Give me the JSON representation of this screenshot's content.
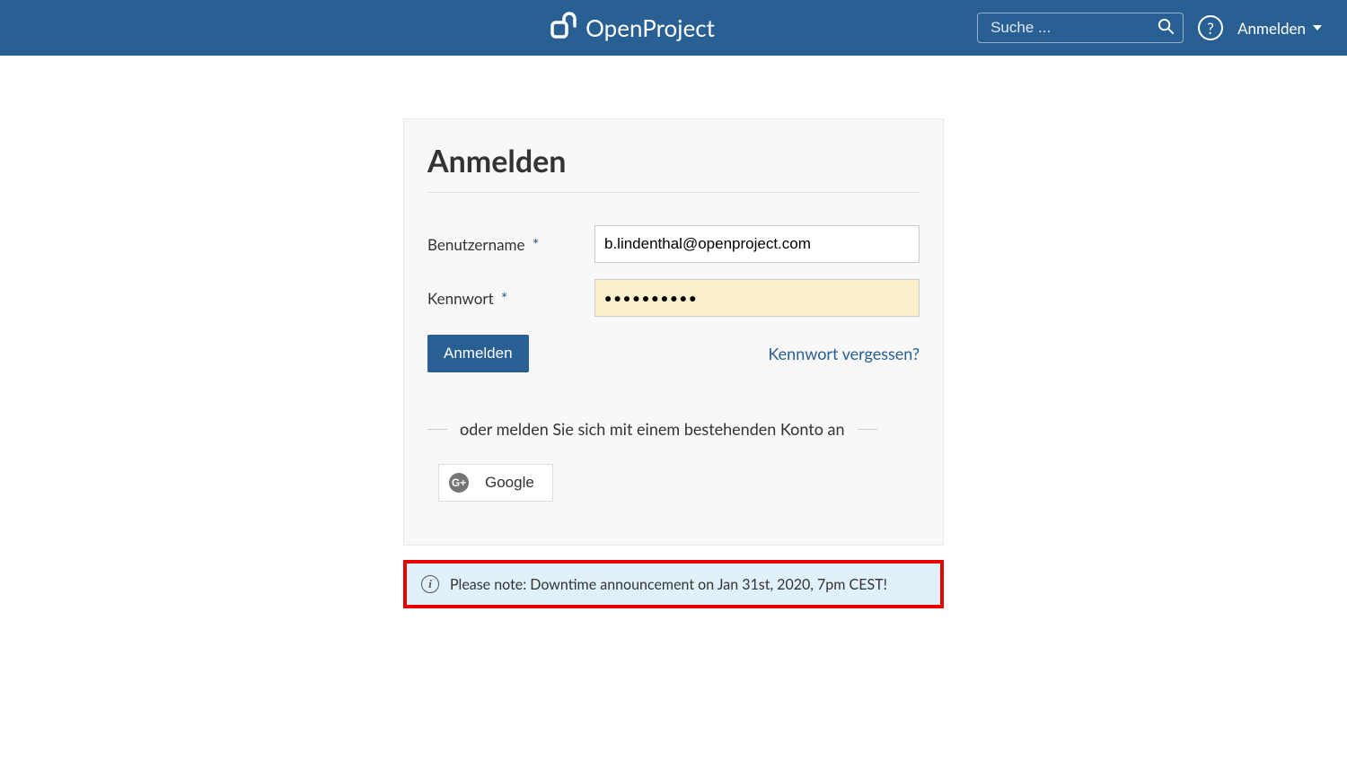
{
  "header": {
    "brand": "OpenProject",
    "search_placeholder": "Suche ...",
    "login_label": "Anmelden"
  },
  "login": {
    "title": "Anmelden",
    "username_label": "Benutzername",
    "password_label": "Kennwort",
    "username_value": "b.lindenthal@openproject.com",
    "password_value": "●●●●●●●●●●",
    "submit_label": "Anmelden",
    "forgot_label": "Kennwort vergessen?",
    "oauth_divider": "oder melden Sie sich mit einem bestehenden Konto an",
    "google_label": "Google"
  },
  "notice": {
    "text": "Please note: Downtime announcement on Jan 31st, 2020, 7pm CEST!"
  }
}
